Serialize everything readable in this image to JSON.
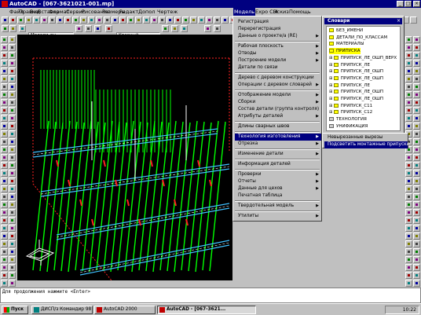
{
  "window": {
    "title": "AutoCAD - [067-3621021-001.mp]",
    "minimize_glyph": "_",
    "maximize_glyph": "□",
    "close_glyph": "×"
  },
  "menubar": {
    "items": [
      "Файл",
      "Правка",
      "Вид",
      "Вставка",
      "Формат",
      "Сервис",
      "Рисование",
      "Размеры",
      "Редакт",
      "Допол",
      "Чертеж",
      "Модель",
      "Expo CI4",
      "Эскиз",
      "Помощь"
    ],
    "active_index": 11
  },
  "toolbar": {
    "layer_value": "Модели_вн",
    "color_value": "Красный"
  },
  "model_menu": {
    "items": [
      {
        "label": "Регистрация",
        "submenu": false
      },
      {
        "label": "Перерегистрация",
        "submenu": false
      },
      {
        "label": "Данные о проекте/а (RE)",
        "submenu": true
      },
      {
        "sep": true
      },
      {
        "label": "Рабочая плоскость",
        "submenu": true
      },
      {
        "label": "Отводы",
        "submenu": true
      },
      {
        "label": "Построение модели",
        "submenu": true
      },
      {
        "label": "Детали по связи",
        "submenu": false
      },
      {
        "sep": true
      },
      {
        "label": "Дерево с деревом конструкции",
        "submenu": false
      },
      {
        "label": "Операции с деревом словарей",
        "submenu": true
      },
      {
        "sep": true
      },
      {
        "label": "Отображение модели",
        "submenu": true
      },
      {
        "label": "Сборки",
        "submenu": true
      },
      {
        "label": "Состав детали (группа контроля)",
        "submenu": false
      },
      {
        "label": "Атрибуты деталей",
        "submenu": true
      },
      {
        "sep": true
      },
      {
        "label": "Длины сварных швов",
        "submenu": false
      },
      {
        "sep": true
      },
      {
        "label": "Технология изготовления",
        "submenu": true,
        "selected": true
      },
      {
        "label": "Отрезка",
        "submenu": true
      },
      {
        "sep": true
      },
      {
        "label": "Изменение детали",
        "submenu": true
      },
      {
        "sep": true
      },
      {
        "label": "Информация деталей",
        "submenu": false
      },
      {
        "sep": true
      },
      {
        "label": "Проверки",
        "submenu": true
      },
      {
        "label": "Отчеты",
        "submenu": true
      },
      {
        "label": "Данные для цехов",
        "submenu": true
      },
      {
        "label": "Печатная таблица",
        "submenu": false
      },
      {
        "sep": true
      },
      {
        "label": "Твердотельная модель",
        "submenu": true
      },
      {
        "sep": true
      },
      {
        "label": "Утилиты",
        "submenu": true
      }
    ]
  },
  "submenu": {
    "items": [
      {
        "label": "Невырезанные вырезы",
        "selected": false
      },
      {
        "label": "Подсветить монтажные припуски",
        "selected": true
      }
    ]
  },
  "dictionary_panel": {
    "title": "Словари",
    "items": [
      {
        "label": "БЕЗ_ИМЕНИ",
        "indent": 1,
        "expand": false,
        "gray": false
      },
      {
        "label": "ДЕТАЛИ_ПО_КЛАССАМ",
        "indent": 1,
        "expand": false,
        "gray": false
      },
      {
        "label": "МАТЕРИАЛЫ",
        "indent": 1,
        "expand": false,
        "gray": false
      },
      {
        "label": "ПРИПУСКА",
        "indent": 1,
        "expand": false,
        "gray": false,
        "highlight": true
      },
      {
        "label": "ПРИПУСК_ЛЕ_ОШП_ВЕРХ",
        "indent": 2,
        "expand": true,
        "gray": false
      },
      {
        "label": "ПРИПУСК_ЛЕ",
        "indent": 2,
        "expand": true,
        "gray": false
      },
      {
        "label": "ПРИПУСК_ЛЕ_ОШП",
        "indent": 2,
        "expand": true,
        "gray": false
      },
      {
        "label": "ПРИПУСК_ЛЕ_ОШП",
        "indent": 2,
        "expand": true,
        "gray": false
      },
      {
        "label": "ПРИПУСК_ЛЕ",
        "indent": 2,
        "expand": true,
        "gray": false
      },
      {
        "label": "ПРИПУСК_ЛЕ_ОШП",
        "indent": 2,
        "expand": true,
        "gray": false
      },
      {
        "label": "ПРИПУСК_ЛЕ_ОШП",
        "indent": 2,
        "expand": true,
        "gray": false
      },
      {
        "label": "ПРИПУСК_С11",
        "indent": 2,
        "expand": true,
        "gray": false
      },
      {
        "label": "ПРИПУСК_С12",
        "indent": 2,
        "expand": true,
        "gray": false
      },
      {
        "label": "ТЕХНОЛОГИЯ",
        "indent": 1,
        "expand": false,
        "gray": true
      },
      {
        "label": "УНИФИКАЦИЯ",
        "indent": 1,
        "expand": false,
        "gray": true
      }
    ]
  },
  "command_line": {
    "text": "Для продолжения нажмите <Enter>"
  },
  "taskbar": {
    "start_label": "Пуск",
    "tasks": [
      {
        "label": "ДИСП/з Командир 98",
        "active": false
      },
      {
        "label": "AutoCAD 2000",
        "active": false
      },
      {
        "label": "AutoCAD - [067-3621...",
        "active": true
      },
      {
        "label": "",
        "active": false
      }
    ],
    "clock": "10:22"
  },
  "colors": {
    "title_bar": "#000080",
    "canvas_bg": "#000000",
    "model_green": "#00ff00",
    "model_red": "#ff2020",
    "model_cyan": "#40c0ff",
    "model_white": "#ffffff",
    "tree_highlight": "#ffff00",
    "selection": "#000080"
  }
}
